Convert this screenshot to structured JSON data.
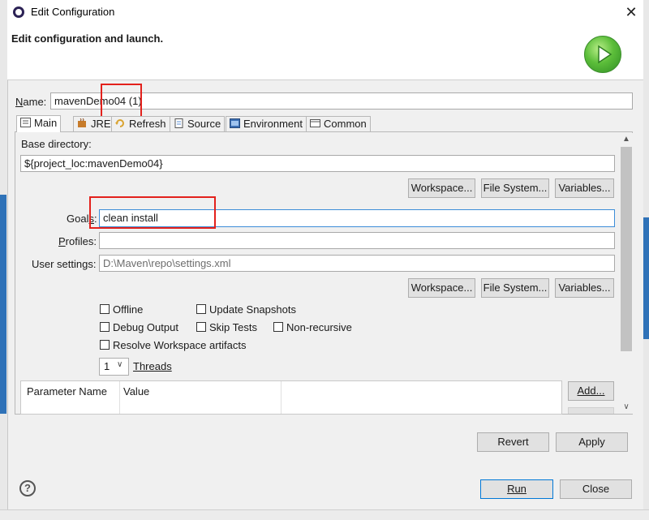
{
  "window": {
    "title": "Edit Configuration",
    "close_glyph": "✕"
  },
  "banner": {
    "title": "Edit configuration and launch.",
    "icon": "run-icon"
  },
  "name": {
    "label": "Name:",
    "value": "mavenDemo04 (1)"
  },
  "tabs": [
    {
      "label": "Main",
      "icon": "main-tab-icon",
      "active": true
    },
    {
      "label": "JRE",
      "icon": "jre-icon"
    },
    {
      "label": "Refresh",
      "icon": "refresh-icon"
    },
    {
      "label": "Source",
      "icon": "source-icon"
    },
    {
      "label": "Environment",
      "icon": "environment-icon"
    },
    {
      "label": "Common",
      "icon": "common-icon"
    }
  ],
  "main": {
    "base_dir_label": "Base directory:",
    "base_dir_value": "${project_loc:mavenDemo04}",
    "workspace_btn": "Workspace...",
    "filesystem_btn": "File System...",
    "variables_btn": "Variables...",
    "goals_label": "Goals:",
    "goals_value": "clean  install",
    "profiles_label": "Profiles:",
    "profiles_value": "",
    "user_settings_label": "User settings:",
    "user_settings_value": "D:\\Maven\\repo\\settings.xml",
    "checkboxes": {
      "offline": "Offline",
      "update_snapshots": "Update Snapshots",
      "debug_output": "Debug Output",
      "skip_tests": "Skip Tests",
      "non_recursive": "Non-recursive",
      "resolve_workspace": "Resolve Workspace artifacts"
    },
    "threads_value": "1",
    "threads_label": "Threads",
    "table_headers": [
      "Parameter Name",
      "Value"
    ],
    "add_btn": "Add..."
  },
  "footer": {
    "revert_btn": "Revert",
    "apply_btn": "Apply",
    "run_btn": "Run",
    "close_btn": "Close",
    "help_glyph": "?"
  }
}
